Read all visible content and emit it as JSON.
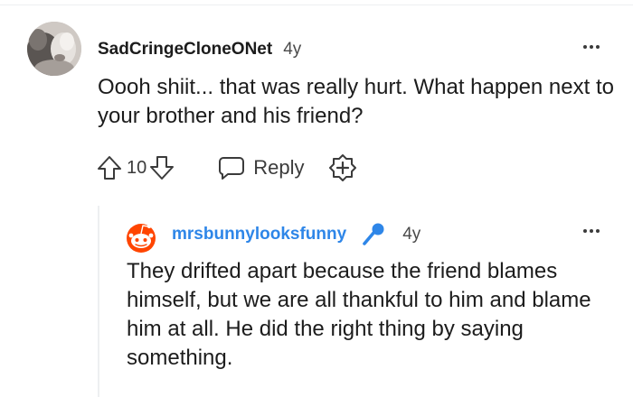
{
  "parent_comment": {
    "username": "SadCringeCloneONet",
    "timestamp": "4y",
    "body": "Oooh shiit... that was really hurt. What happen next to your brother and his friend?",
    "vote_count": "10",
    "reply_label": "Reply",
    "icons": {
      "avatar": "user-avatar-photo",
      "more": "more-options-icon",
      "upvote": "upvote-arrow-icon",
      "downvote": "downvote-arrow-icon",
      "reply": "comment-bubble-icon",
      "award": "award-plus-icon"
    }
  },
  "child_comment": {
    "username": "mrsbunnylooksfunny",
    "timestamp": "4y",
    "body": "They drifted apart because the friend blames himself, but we are all thankful to him and blame him at all. He did the right thing by saying something.",
    "icons": {
      "avatar": "reddit-snoo-avatar",
      "badge": "microphone-icon",
      "more": "more-options-icon"
    }
  },
  "colors": {
    "child_username": "#2e86e8",
    "badge_blue": "#2e86e8",
    "snoo_orange": "#ff4500",
    "text": "#1c1c1c",
    "meta": "#4a4a4a"
  }
}
